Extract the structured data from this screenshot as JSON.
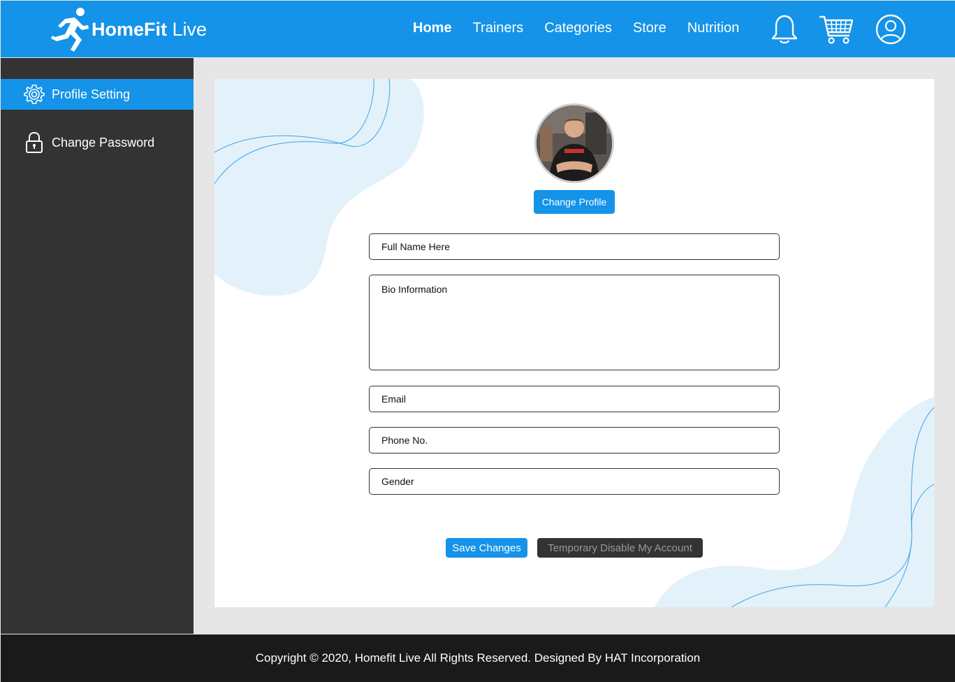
{
  "brand": {
    "name_bold": "HomeFit",
    "name_light": "Live"
  },
  "nav": {
    "items": [
      {
        "label": "Home",
        "active": true
      },
      {
        "label": "Trainers"
      },
      {
        "label": "Categories"
      },
      {
        "label": "Store"
      },
      {
        "label": "Nutrition"
      }
    ],
    "icons": [
      "bell-icon",
      "cart-icon",
      "user-icon"
    ]
  },
  "sidebar": {
    "items": [
      {
        "label": "Profile Setting",
        "icon": "gear-icon",
        "active": true
      },
      {
        "label": "Change Password",
        "icon": "lock-icon"
      }
    ]
  },
  "profile": {
    "change_profile_label": "Change Profile",
    "full_name_placeholder": "Full Name Here",
    "bio_placeholder": "Bio Information",
    "email_placeholder": "Email",
    "phone_placeholder": "Phone No.",
    "gender_placeholder": "Gender",
    "save_label": "Save Changes",
    "disable_label": "Temporary Disable My Account"
  },
  "footer": {
    "text": "Copyright © 2020, Homefit Live All Rights Reserved. Designed By HAT Incorporation"
  },
  "colors": {
    "accent": "#1493e8",
    "sidebar": "#333333",
    "footer": "#1a1a1a",
    "deco": "#e3f1fb"
  }
}
